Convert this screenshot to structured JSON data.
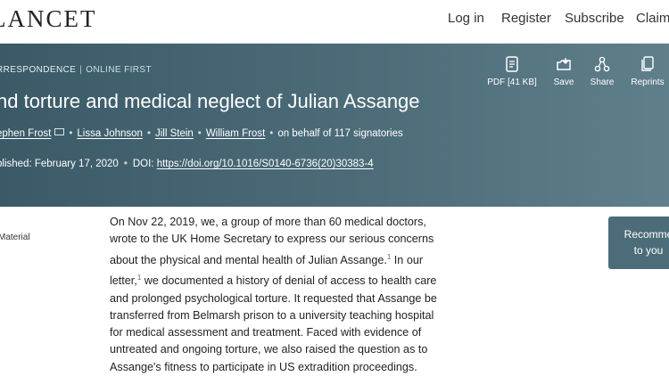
{
  "header": {
    "logo": "LANCET",
    "nav": [
      "Log in",
      "Register",
      "Subscribe",
      "Claim"
    ]
  },
  "hero": {
    "crumb_section": "RRESPONDENCE",
    "crumb_status": "ONLINE FIRST",
    "title": "nd torture and medical neglect of Julian Assange",
    "authors": [
      "ephen Frost",
      "Lissa Johnson",
      "Jill Stein",
      "William Frost"
    ],
    "on_behalf": "on behalf of 117 signatories",
    "published_label": "blished: February 17, 2020",
    "doi_label": "DOI:",
    "doi_link": "https://doi.org/10.1016/S0140-6736(20)30383-4",
    "actions": [
      {
        "label": "PDF [41 KB]",
        "icon": "pdf-icon"
      },
      {
        "label": "Save",
        "icon": "save-icon"
      },
      {
        "label": "Share",
        "icon": "share-icon"
      },
      {
        "label": "Reprints",
        "icon": "reprints-icon"
      }
    ],
    "background": "#4d6c79"
  },
  "sidebar": {
    "material": "Material"
  },
  "article": {
    "p1_a": "On Nov 22, 2019, we, a group of more than 60 medical doctors, wrote to the UK Home Secretary to express our serious concerns about the physical and mental health of Julian Assange.",
    "ref1": "1",
    "p1_b": " In our letter,",
    "ref2": "1",
    "p1_c": " we documented a history of denial of access to health care and prolonged psychological torture. It requested that Assange be transferred from Belmarsh prison to a university teaching hospital for medical assessment and treatment. Faced with evidence of untreated and ongoing torture, we also raised the question as to Assange's fitness to participate in US extradition proceedings."
  },
  "recommend": {
    "line1": "Recomme",
    "line2": "to you"
  }
}
